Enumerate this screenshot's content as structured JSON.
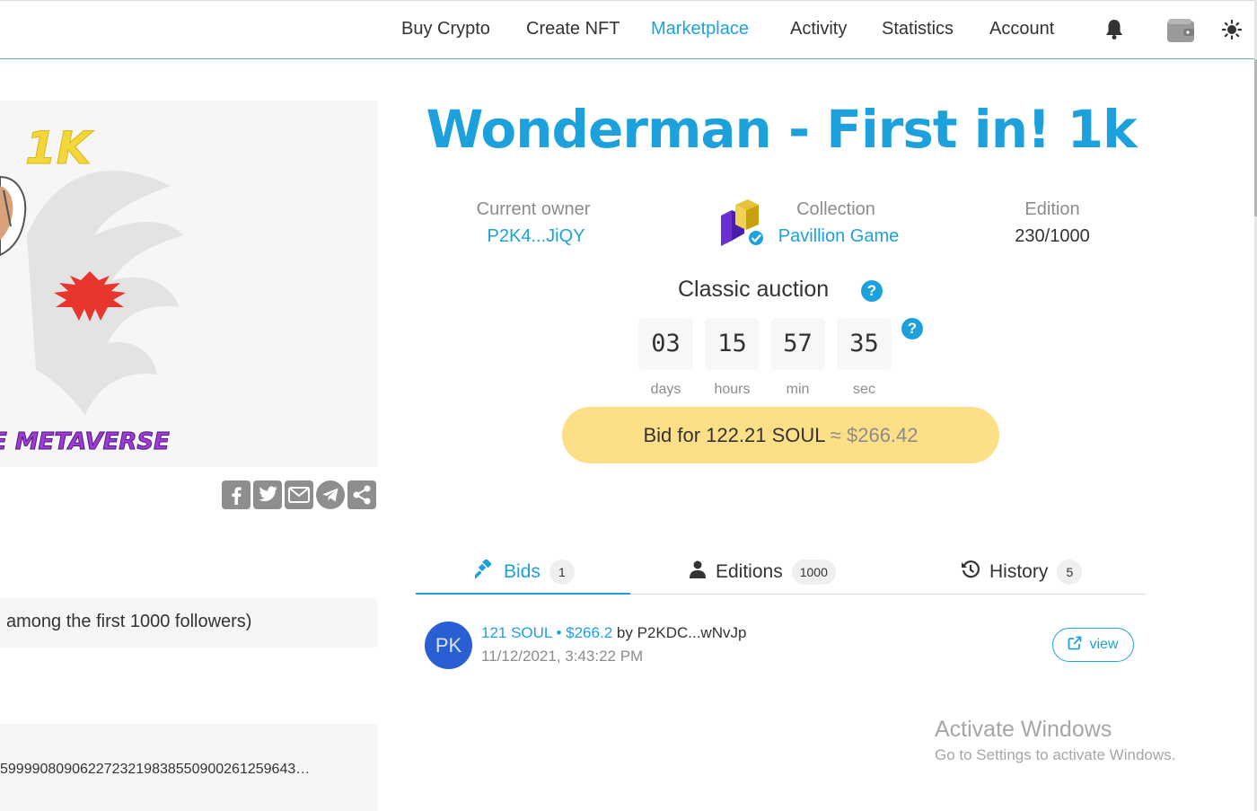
{
  "nav": {
    "items": [
      {
        "label": "Buy Crypto"
      },
      {
        "label": "Create NFT"
      },
      {
        "label": "Marketplace",
        "active": true
      },
      {
        "label": "Activity"
      },
      {
        "label": "Statistics"
      },
      {
        "label": "Account"
      }
    ],
    "icons": [
      "bell-icon",
      "wallet-icon",
      "theme-sun-icon"
    ]
  },
  "nft": {
    "image_text_top": "1K",
    "image_text_bottom": "E METAVERSE",
    "title": "Wonderman - First in! 1k",
    "owner_label": "Current owner",
    "owner_value": "P2K4...JiQY",
    "collection_label": "Collection",
    "collection_value": "Pavillion Game",
    "edition_label": "Edition",
    "edition_value": "230/1000",
    "description_snippet": "among the first 1000 followers)",
    "token_id_snippet": "5999908090622723219838550900261259643…"
  },
  "share": {
    "icons": [
      "facebook-icon",
      "twitter-icon",
      "email-icon",
      "telegram-icon",
      "share-icon"
    ]
  },
  "auction": {
    "title": "Classic auction",
    "help": "?",
    "countdown": [
      {
        "value": "03",
        "unit": "days"
      },
      {
        "value": "15",
        "unit": "hours"
      },
      {
        "value": "57",
        "unit": "min"
      },
      {
        "value": "35",
        "unit": "sec"
      }
    ],
    "bid_label": "Bid for 122.21 SOUL",
    "bid_usd": "≈ $266.42"
  },
  "tabs": [
    {
      "label": "Bids",
      "count": "1",
      "icon": "gavel-icon",
      "active": true
    },
    {
      "label": "Editions",
      "count": "1000",
      "icon": "user-icon"
    },
    {
      "label": "History",
      "count": "5",
      "icon": "history-icon"
    }
  ],
  "bids": [
    {
      "avatar": "PK",
      "amount": "121 SOUL • $266.2",
      "by_prefix": " by ",
      "bidder": "P2KDC...wNvJp",
      "time": "11/12/2021, 3:43:22 PM",
      "view_label": "view"
    }
  ],
  "watermark": {
    "line1": "Activate Windows",
    "line2": "Go to Settings to activate Windows."
  },
  "colors": {
    "accent": "#1da1dc",
    "bid_button": "#fddf87",
    "avatar": "#2a5fd3"
  }
}
